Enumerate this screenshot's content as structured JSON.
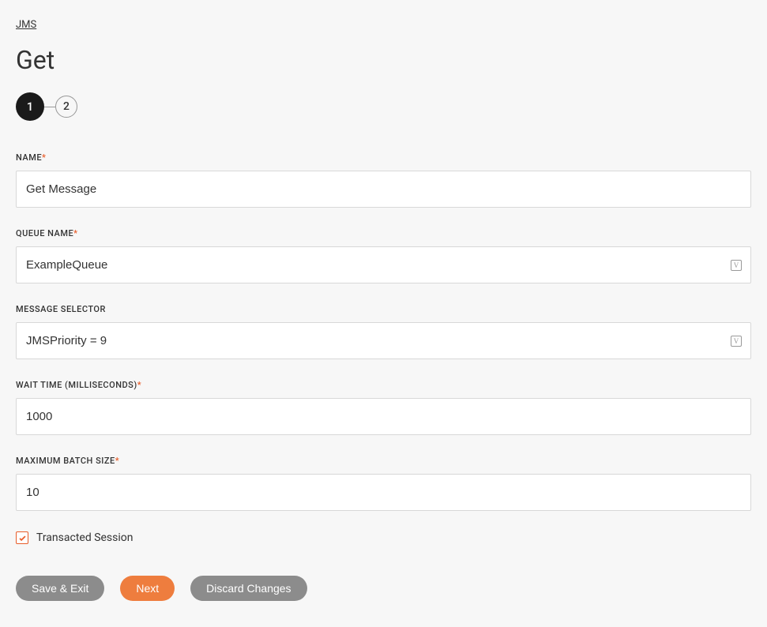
{
  "breadcrumb": {
    "label": "JMS"
  },
  "page": {
    "title": "Get"
  },
  "stepper": {
    "steps": [
      "1",
      "2"
    ],
    "active": 0
  },
  "form": {
    "name": {
      "label": "NAME",
      "value": "Get Message",
      "required": true
    },
    "queueName": {
      "label": "QUEUE NAME",
      "value": "ExampleQueue",
      "required": true,
      "hasVariable": true
    },
    "messageSelector": {
      "label": "MESSAGE SELECTOR",
      "value": "JMSPriority = 9",
      "required": false,
      "hasVariable": true
    },
    "waitTime": {
      "label": "WAIT TIME (MILLISECONDS)",
      "value": "1000",
      "required": true
    },
    "maxBatchSize": {
      "label": "MAXIMUM BATCH SIZE",
      "value": "10",
      "required": true
    },
    "transactedSession": {
      "label": "Transacted Session",
      "checked": true
    }
  },
  "buttons": {
    "saveExit": "Save & Exit",
    "next": "Next",
    "discard": "Discard Changes"
  }
}
